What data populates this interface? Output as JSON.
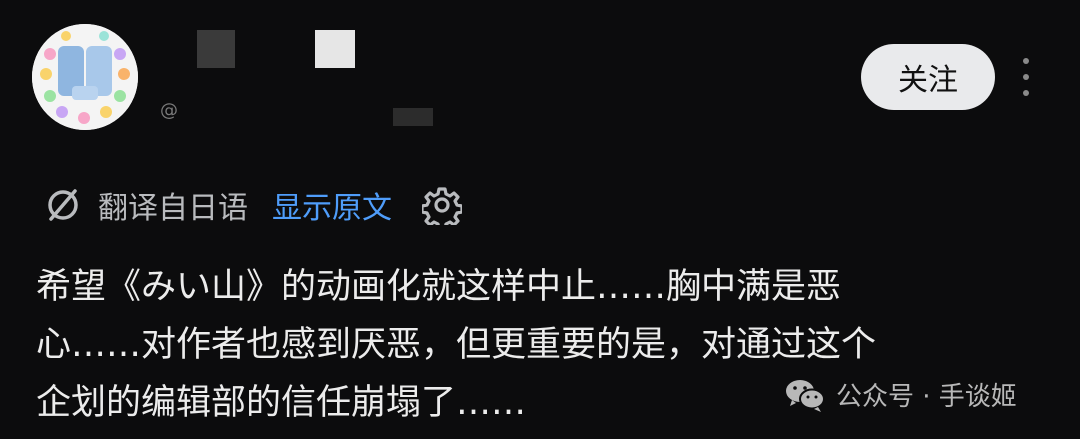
{
  "post": {
    "author": {
      "avatar_icon": "pastel-square-avatar-icon"
    },
    "follow_label": "关注",
    "more_icon": "vertical-dots-icon",
    "translation": {
      "icon": "translate-icon",
      "label": "翻译自日语",
      "show_original_label": "显示原文",
      "settings_icon": "gear-icon",
      "link_color": "#4f9dfa"
    },
    "body_text": "希望《みい山》的动画化就这样中止……胸中满是恶\n心……对作者也感到厌恶，但更重要的是，对通过这个\n企划的编辑部的信任崩塌了……"
  },
  "watermark": {
    "icon": "wechat-icon",
    "text": "公众号 · 手谈姬"
  },
  "colors": {
    "background": "#0c0c0d",
    "follow_button_bg": "#e9eaec"
  }
}
